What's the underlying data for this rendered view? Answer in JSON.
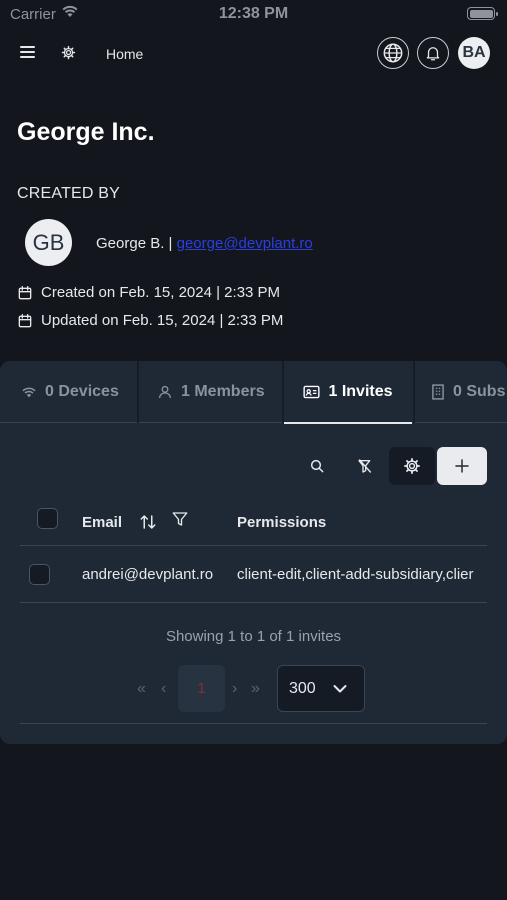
{
  "status_bar": {
    "carrier": "Carrier",
    "time": "12:38 PM"
  },
  "header": {
    "home_label": "Home",
    "user_initials": "BA"
  },
  "org": {
    "name": "George Inc."
  },
  "created_by": {
    "label": "CREATED BY",
    "initials": "GB",
    "name": "George B. | ",
    "email": "george@devplant.ro"
  },
  "dates": {
    "created": "Created on Feb. 15, 2024 | 2:33 PM",
    "updated": "Updated on Feb. 15, 2024 | 2:33 PM"
  },
  "tabs": [
    {
      "label": "0 Devices",
      "icon": "wifi-icon"
    },
    {
      "label": "1 Members",
      "icon": "user-icon"
    },
    {
      "label": "1 Invites",
      "icon": "id-card-icon",
      "active": true
    },
    {
      "label": "0 Subs",
      "icon": "building-icon"
    }
  ],
  "table": {
    "columns": [
      "Email",
      "Permissions"
    ],
    "rows": [
      {
        "email": "andrei@devplant.ro",
        "permissions": "client-edit,client-add-subsidiary,clier"
      }
    ]
  },
  "pagination": {
    "summary": "Showing 1 to 1 of 1 invites",
    "first": "«",
    "prev": "‹",
    "current_page": "1",
    "next": "›",
    "last": "»",
    "page_size": "300"
  },
  "colors": {
    "background": "#13161c",
    "card": "#1f2935",
    "link": "#2b3ee6"
  }
}
